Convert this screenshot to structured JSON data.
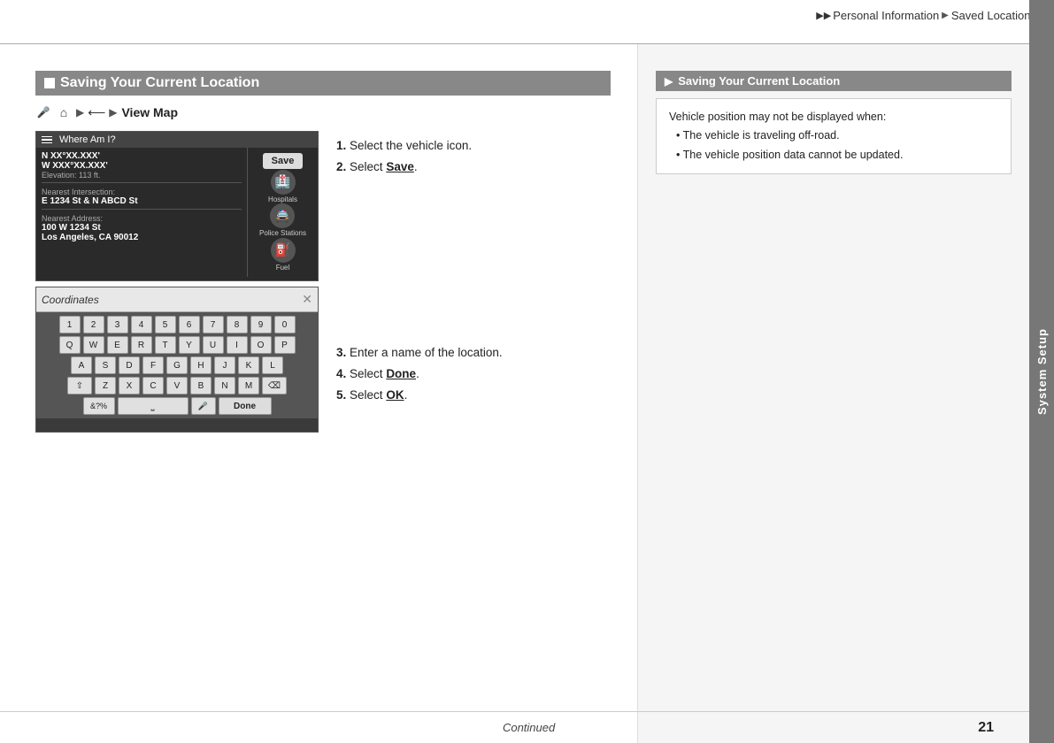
{
  "header": {
    "breadcrumb": [
      "Personal Information",
      "Saved Locations"
    ],
    "arrows": [
      "▶▶",
      "▶"
    ]
  },
  "sidebar": {
    "label": "System Setup"
  },
  "section": {
    "title": "Saving Your Current Location",
    "nav": {
      "icons": [
        "🎤",
        "🏠",
        "▶",
        "⟵",
        "▶"
      ],
      "label": "View Map"
    },
    "screen1": {
      "header": "Where Am I?",
      "coords_label": "N XX°XX.XXX'",
      "coords_label2": "W XXX°XX.XXX'",
      "elevation": "Elevation: 113 ft.",
      "nearest_label": "Nearest Intersection:",
      "nearest_value": "E 1234 St & N ABCD St",
      "address_label": "Nearest Address:",
      "address_value": "100 W 1234 St",
      "address_city": "Los Angeles, CA 90012",
      "save_btn": "Save",
      "icons": [
        "Hospitals",
        "Police Stations",
        "Fuel"
      ]
    },
    "screen2": {
      "title": "Coordinates",
      "rows": [
        [
          "1",
          "2",
          "3",
          "4",
          "5",
          "6",
          "7",
          "8",
          "9",
          "0"
        ],
        [
          "Q",
          "W",
          "E",
          "R",
          "T",
          "Y",
          "U",
          "I",
          "O",
          "P"
        ],
        [
          "A",
          "S",
          "D",
          "F",
          "G",
          "H",
          "J",
          "K",
          "L"
        ],
        [
          "⇧",
          "Z",
          "X",
          "C",
          "V",
          "B",
          "N",
          "M",
          "⌫"
        ]
      ],
      "bottom": [
        "&?%",
        "⎵",
        "🎤",
        "Done"
      ]
    },
    "instructions": [
      {
        "num": "1.",
        "text": "Select the vehicle icon."
      },
      {
        "num": "2.",
        "text": "Select ",
        "bold": "Save",
        "rest": "."
      },
      {
        "num": "3.",
        "text": "Enter a name of the location."
      },
      {
        "num": "4.",
        "text": "Select ",
        "bold": "Done",
        "rest": "."
      },
      {
        "num": "5.",
        "text": "Select ",
        "bold": "OK",
        "rest": "."
      }
    ]
  },
  "note": {
    "title": "Saving Your Current Location",
    "intro": "Vehicle position may not be displayed when:",
    "items": [
      "The vehicle is traveling off-road.",
      "The vehicle position data cannot be updated."
    ]
  },
  "footer": {
    "continued": "Continued",
    "page": "21"
  }
}
